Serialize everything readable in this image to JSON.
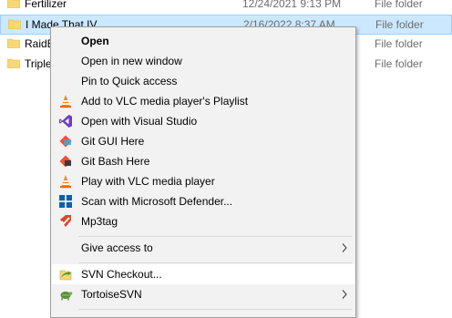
{
  "files": [
    {
      "name": "Fertilizer",
      "date": "12/24/2021 9:13 PM",
      "type": "File folder"
    },
    {
      "name": "I Made That IV",
      "date": "2/16/2022 8:37 AM",
      "type": "File folder"
    },
    {
      "name": "RaidB",
      "date": "",
      "type": "File folder"
    },
    {
      "name": "Triple",
      "date": "",
      "type": "File folder"
    }
  ],
  "menu": {
    "open": "Open",
    "open_new_window": "Open in new window",
    "pin_quick_access": "Pin to Quick access",
    "add_vlc_playlist": "Add to VLC media player's Playlist",
    "open_visual_studio": "Open with Visual Studio",
    "git_gui": "Git GUI Here",
    "git_bash": "Git Bash Here",
    "play_vlc": "Play with VLC media player",
    "scan_defender": "Scan with Microsoft Defender...",
    "mp3tag": "Mp3tag",
    "give_access": "Give access to",
    "svn_checkout": "SVN Checkout...",
    "tortoisesvn": "TortoiseSVN"
  },
  "colors": {
    "selection": "#cce8ff",
    "menu_bg": "#f2f2f2",
    "hover": "#ffffff",
    "folder": "#f8d775"
  }
}
